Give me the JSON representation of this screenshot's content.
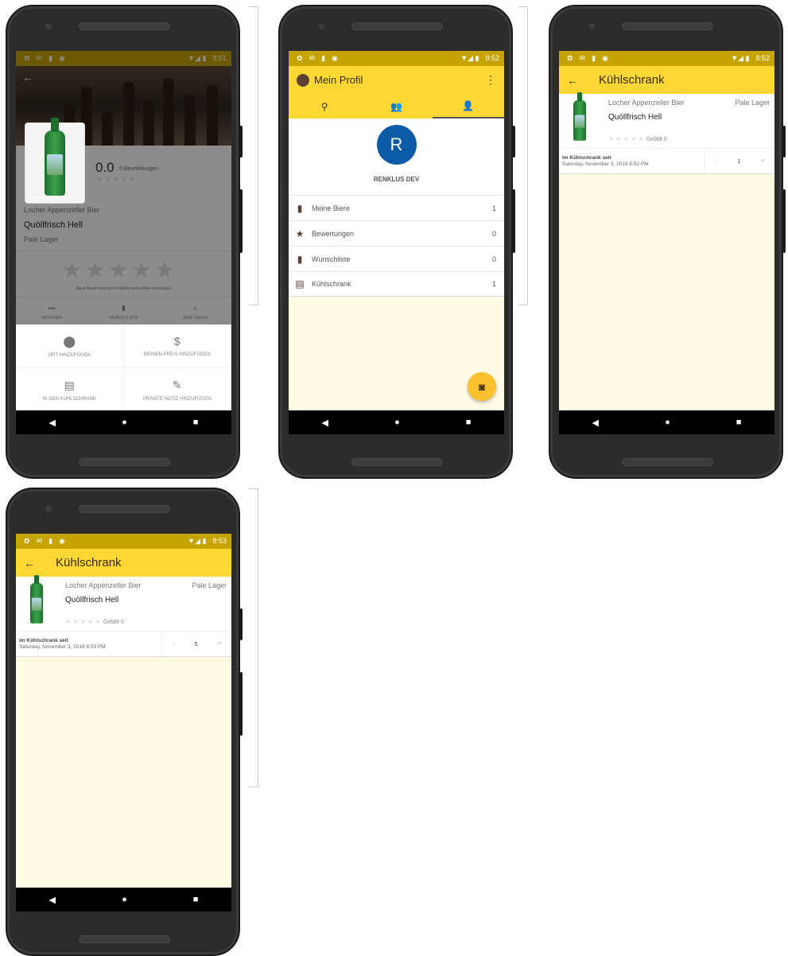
{
  "status": {
    "time_1": "8:51",
    "time_2": "8:52",
    "time_3": "8:52",
    "time_4": "8:53"
  },
  "detail": {
    "rating_value": "0.0",
    "rating_count": "0 Beurteilungen",
    "brewery": "Locher Appenzeller Bier",
    "beer_name": "Quöllfrisch Hell",
    "style": "Pale Lager",
    "rating_hint": "Neue Bewertung durch klicken und ziehen hinzufügen",
    "actions": {
      "label": "AKTIONEN",
      "wishlist": "WUNSCHLISTE",
      "share": "BIER TEILEN"
    },
    "sheet": {
      "location": "ORT HINZUFÜGEN",
      "price": "MEINEN PREIS HINZUFÜGEN",
      "fridge": "IN DEN KÜHLSCHRANK",
      "note": "PRIVATE NOTIZ HINZUFÜGEN"
    }
  },
  "profile": {
    "title": "Mein Profil",
    "avatar_letter": "R",
    "user_name": "RENKLUS DEV",
    "items": [
      {
        "label": "Meine Biere",
        "count": "1",
        "icon": "bottle-icon"
      },
      {
        "label": "Bewertungen",
        "count": "0",
        "icon": "star-icon"
      },
      {
        "label": "Wunschliste",
        "count": "0",
        "icon": "bookmark-icon"
      },
      {
        "label": "Kühlschrank",
        "count": "1",
        "icon": "fridge-icon"
      }
    ]
  },
  "fridge": {
    "title": "Kühlschrank",
    "brewery": "Locher Appenzeller Bier",
    "style": "Pale Lager",
    "beer_name": "Quöllfrisch Hell",
    "likes_label": "Gefällt 0",
    "since_label": "im Kühlschrank seit",
    "since_date_1": "Saturday, November 3, 2018 8:52 PM",
    "since_date_2": "Saturday, November 3, 2018 8:53 PM",
    "count_1": "1",
    "count_2": "5",
    "minus": "-",
    "plus": "+"
  },
  "colors": {
    "appbar": "#fdd835",
    "statusbar": "#c6a400",
    "avatar": "#0d5aa7",
    "fab": "#fbc02d",
    "background": "#fffbe5"
  }
}
